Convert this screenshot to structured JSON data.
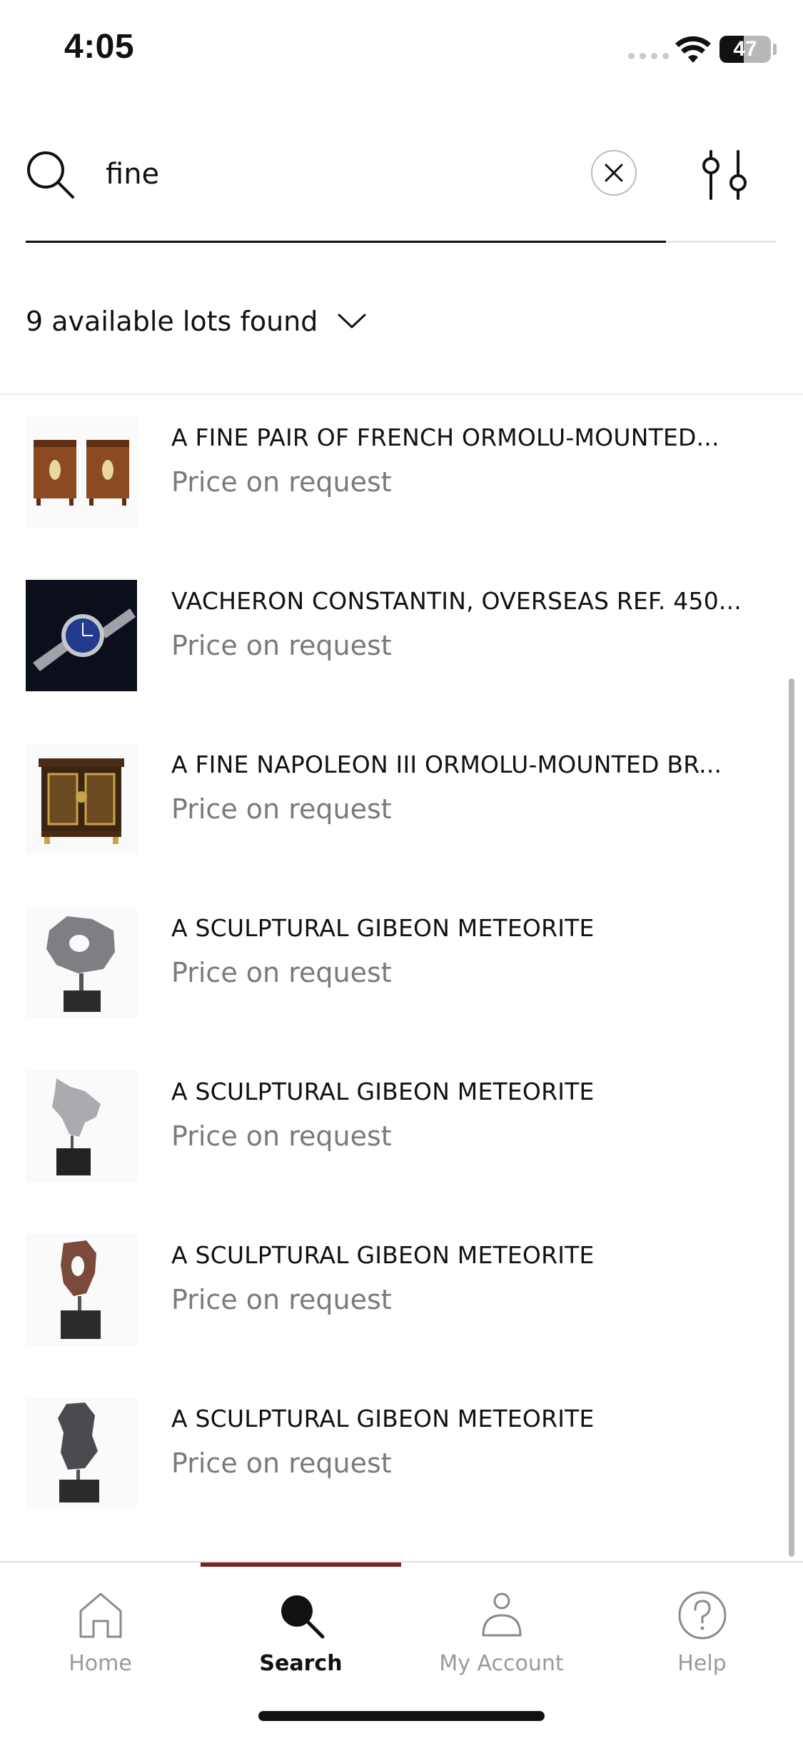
{
  "status_bar": {
    "time": "4:05",
    "battery": "47"
  },
  "search": {
    "value": "fine",
    "placeholder": ""
  },
  "results": {
    "summary": "9 available lots found"
  },
  "lots": [
    {
      "title": "A FINE PAIR OF FRENCH ORMOLU-MOUNTED...",
      "price": "Price on request",
      "thumb": "cabinet-pair"
    },
    {
      "title": "VACHERON CONSTANTIN, OVERSEAS REF. 450...",
      "price": "Price on request",
      "thumb": "watch"
    },
    {
      "title": "A FINE NAPOLEON III ORMOLU-MOUNTED BR...",
      "price": "Price on request",
      "thumb": "cabinet"
    },
    {
      "title": "A SCULPTURAL GIBEON METEORITE",
      "price": "Price on request",
      "thumb": "meteorite"
    },
    {
      "title": "A SCULPTURAL GIBEON METEORITE",
      "price": "Price on request",
      "thumb": "meteorite"
    },
    {
      "title": "A SCULPTURAL GIBEON METEORITE",
      "price": "Price on request",
      "thumb": "meteorite"
    },
    {
      "title": "A SCULPTURAL GIBEON METEORITE",
      "price": "Price on request",
      "thumb": "meteorite"
    }
  ],
  "tabs": [
    {
      "label": "Home",
      "icon": "home-icon"
    },
    {
      "label": "Search",
      "icon": "search-icon",
      "active": true
    },
    {
      "label": "My Account",
      "icon": "person-icon"
    },
    {
      "label": "Help",
      "icon": "help-icon"
    }
  ],
  "colors": {
    "accent": "#7a2322",
    "muted_text": "#7a7a7a",
    "divider": "#ececec"
  }
}
